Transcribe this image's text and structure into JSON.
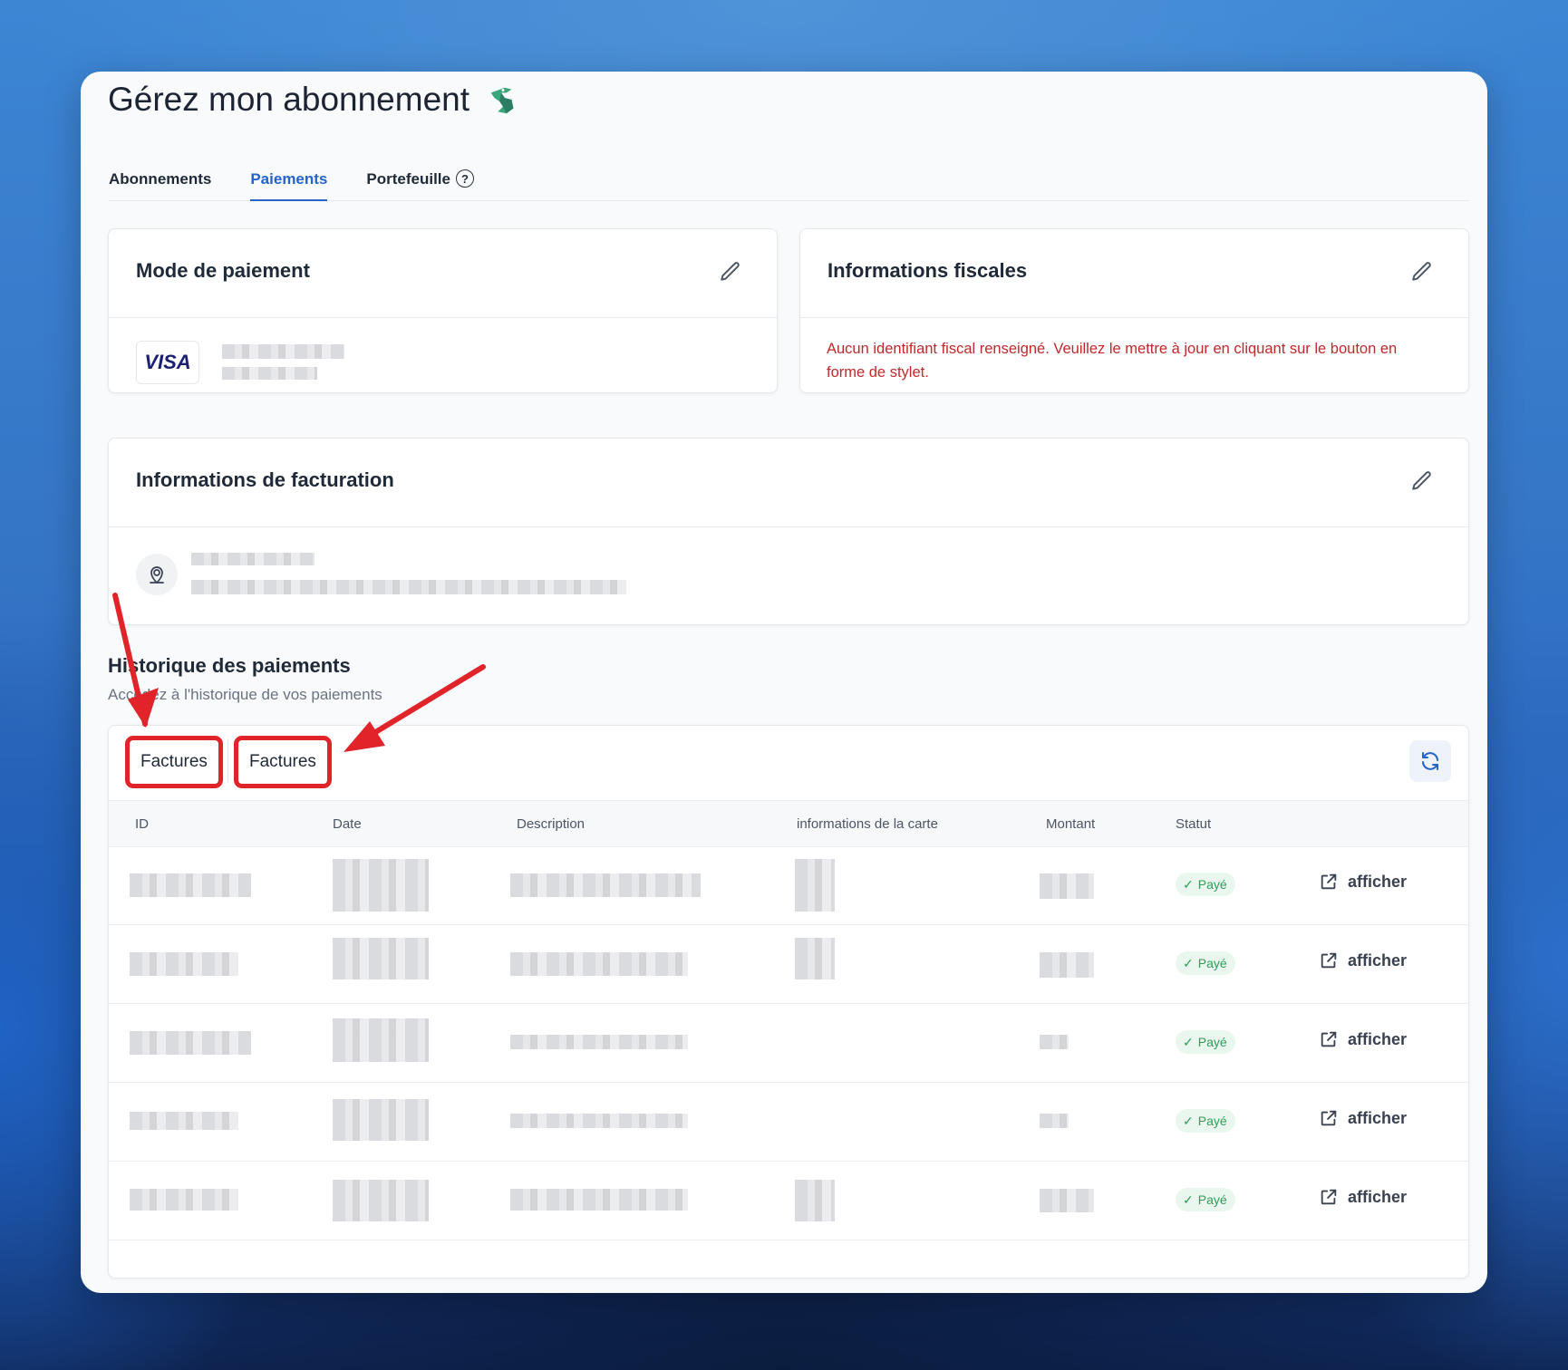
{
  "page": {
    "title": "Gérez mon abonnement",
    "tabs": [
      {
        "label": "Abonnements",
        "active": false
      },
      {
        "label": "Paiements",
        "active": true
      },
      {
        "label": "Portefeuille",
        "active": false
      }
    ]
  },
  "payment_method": {
    "title": "Mode de paiement",
    "card_brand": "VISA"
  },
  "tax_info": {
    "title": "Informations fiscales",
    "message": "Aucun identifiant fiscal renseigné. Veuillez le mettre à jour en cliquant sur le bouton en forme de stylet."
  },
  "billing_info": {
    "title": "Informations de facturation"
  },
  "history": {
    "title": "Historique des paiements",
    "subtitle": "Accédez à l'historique de vos paiements",
    "segments": [
      "Factures",
      "Factures"
    ],
    "columns": [
      "ID",
      "Date",
      "Description",
      "informations de la carte",
      "Montant",
      "Statut"
    ],
    "rows": [
      {
        "status": "Payé",
        "action": "afficher"
      },
      {
        "status": "Payé",
        "action": "afficher"
      },
      {
        "status": "Payé",
        "action": "afficher"
      },
      {
        "status": "Payé",
        "action": "afficher"
      },
      {
        "status": "Payé",
        "action": "afficher"
      }
    ]
  },
  "colors": {
    "accent": "#2563c9",
    "warning_text": "#c0292b",
    "status_paid": "#2f9e5b",
    "annotation_red": "#e0242a"
  }
}
